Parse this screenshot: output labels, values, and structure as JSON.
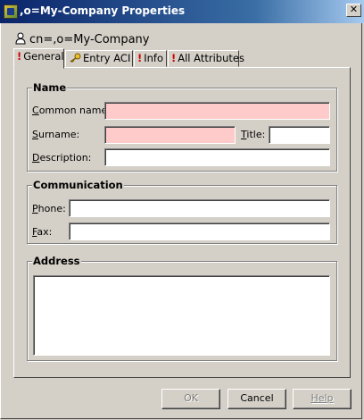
{
  "window": {
    "title": ",o=My-Company Properties",
    "close_glyph": "✕"
  },
  "entry": {
    "dn": "cn=,o=My-Company",
    "icon": "user-icon"
  },
  "tabs": [
    {
      "label": "General",
      "required_marker": "!",
      "active": true
    },
    {
      "label": "Entry ACI",
      "icon": "key-icon",
      "active": false
    },
    {
      "label": "Info",
      "required_marker": "!",
      "active": false
    },
    {
      "label": "All Attributes",
      "required_marker": "!",
      "active": false
    }
  ],
  "name_group": {
    "title": "Name",
    "common_name_label": "Common name:",
    "common_name_value": "",
    "surname_label": "Surname:",
    "surname_value": "",
    "title_label": "Title:",
    "title_value": "",
    "description_label": "Description:",
    "description_value": ""
  },
  "communication_group": {
    "title": "Communication",
    "phone_label": "Phone:",
    "phone_value": "",
    "fax_label": "Fax:",
    "fax_value": ""
  },
  "address_group": {
    "title": "Address",
    "address_value": ""
  },
  "buttons": {
    "ok": "OK",
    "cancel": "Cancel",
    "help": "Help"
  },
  "colors": {
    "required_field": "#ffcaca",
    "title_bar": "#0a246a",
    "required_marker": "#d00000"
  }
}
